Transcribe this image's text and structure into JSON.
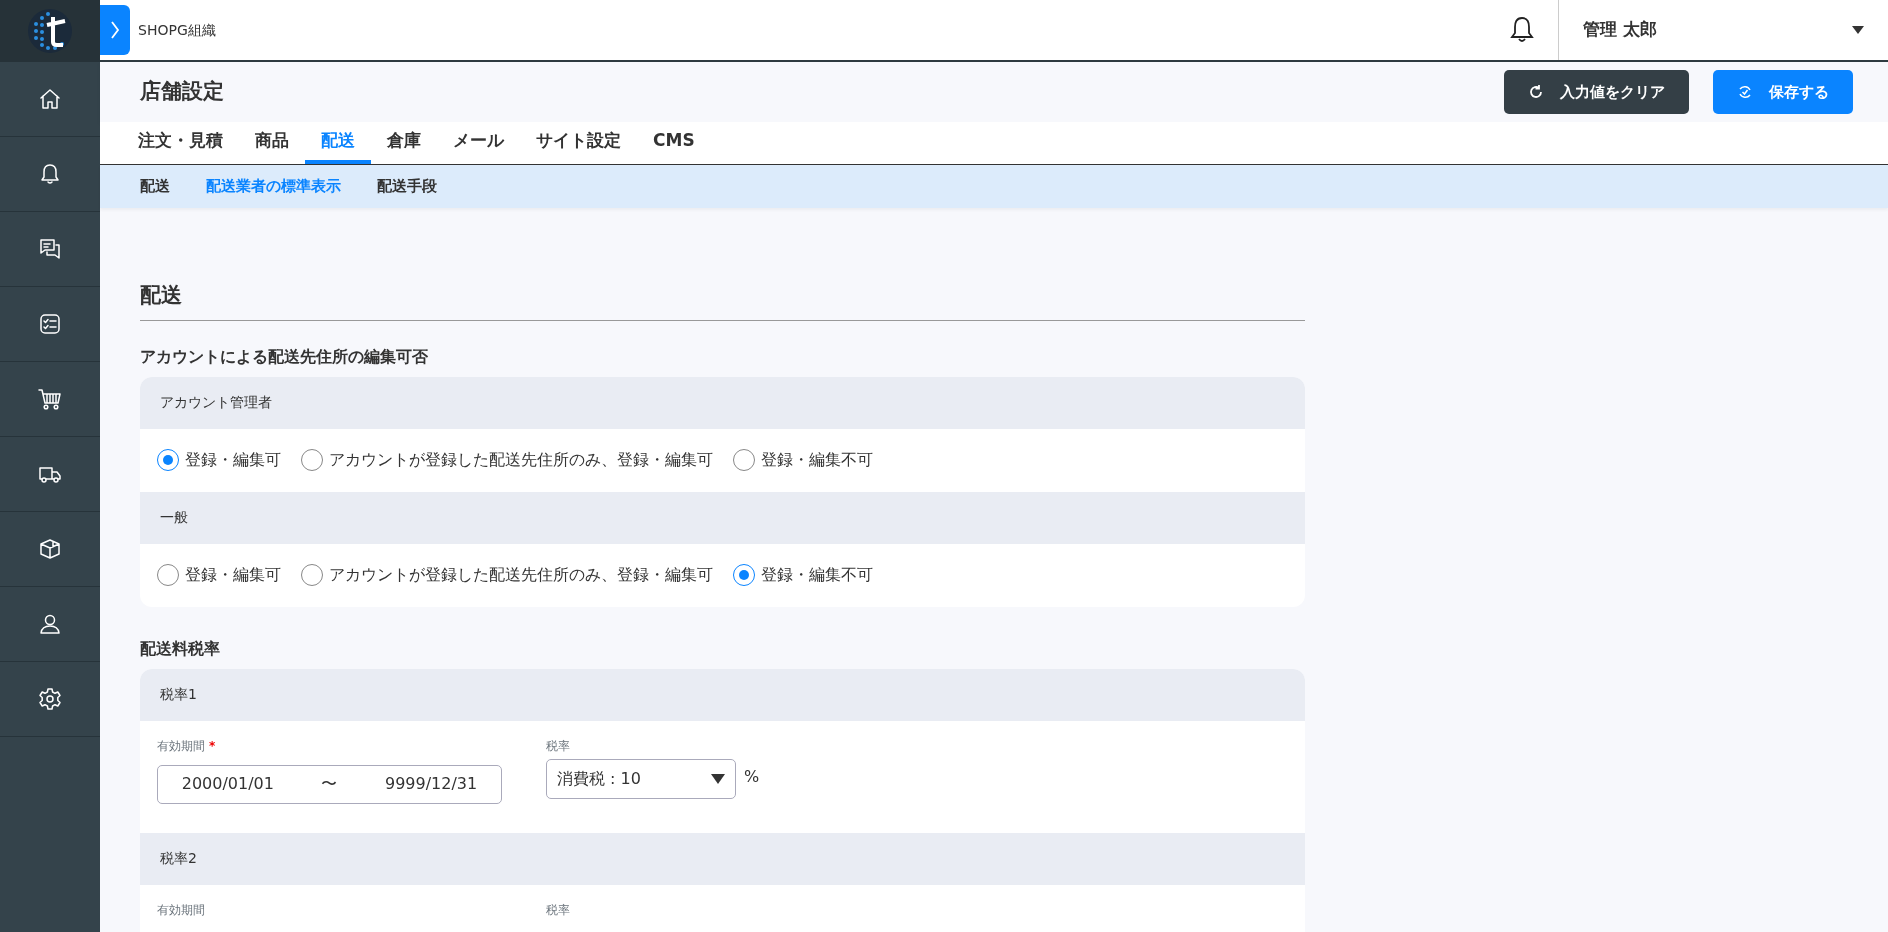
{
  "header": {
    "organization": "SHOPG組織",
    "user": "管理 太郎"
  },
  "page": {
    "title": "店舗設定",
    "buttons": [
      {
        "label": "入力値をクリア",
        "kind": "clear"
      },
      {
        "label": "保存する",
        "kind": "save"
      }
    ]
  },
  "tabs": [
    {
      "label": "注文・見積",
      "selected": false
    },
    {
      "label": "商品",
      "selected": false
    },
    {
      "label": "配送",
      "selected": true
    },
    {
      "label": "倉庫",
      "selected": false
    },
    {
      "label": "メール",
      "selected": false
    },
    {
      "label": "サイト設定",
      "selected": false
    },
    {
      "label": "CMS",
      "selected": false
    }
  ],
  "subtabs": [
    {
      "label": "配送",
      "selected": false
    },
    {
      "label": "配送業者の標準表示",
      "selected": true
    },
    {
      "label": "配送手段",
      "selected": false
    }
  ],
  "section": {
    "title": "配送"
  },
  "groups": [
    {
      "title": "アカウントによる配送先住所の編集可否",
      "kind": "radios",
      "rows": [
        {
          "header": "アカウント管理者",
          "options": [
            {
              "label": "登録・編集可",
              "selected": true
            },
            {
              "label": "アカウントが登録した配送先住所のみ、登録・編集可",
              "selected": false
            },
            {
              "label": "登録・編集不可",
              "selected": false
            }
          ]
        },
        {
          "header": "一般",
          "options": [
            {
              "label": "登録・編集可",
              "selected": false
            },
            {
              "label": "アカウントが登録した配送先住所のみ、登録・編集可",
              "selected": false
            },
            {
              "label": "登録・編集不可",
              "selected": true
            }
          ]
        }
      ]
    },
    {
      "title": "配送料税率",
      "kind": "rates",
      "rows": [
        {
          "header": "税率1",
          "period_label": "有効期間",
          "required_mark": "*",
          "start": "2000/01/01",
          "separator": "〜",
          "end": "9999/12/31",
          "rate_label": "税率",
          "rate": "消費税 : 10",
          "unit": "%"
        },
        {
          "header": "税率2",
          "period_label": "有効期間",
          "rate_label": "税率"
        }
      ]
    }
  ]
}
